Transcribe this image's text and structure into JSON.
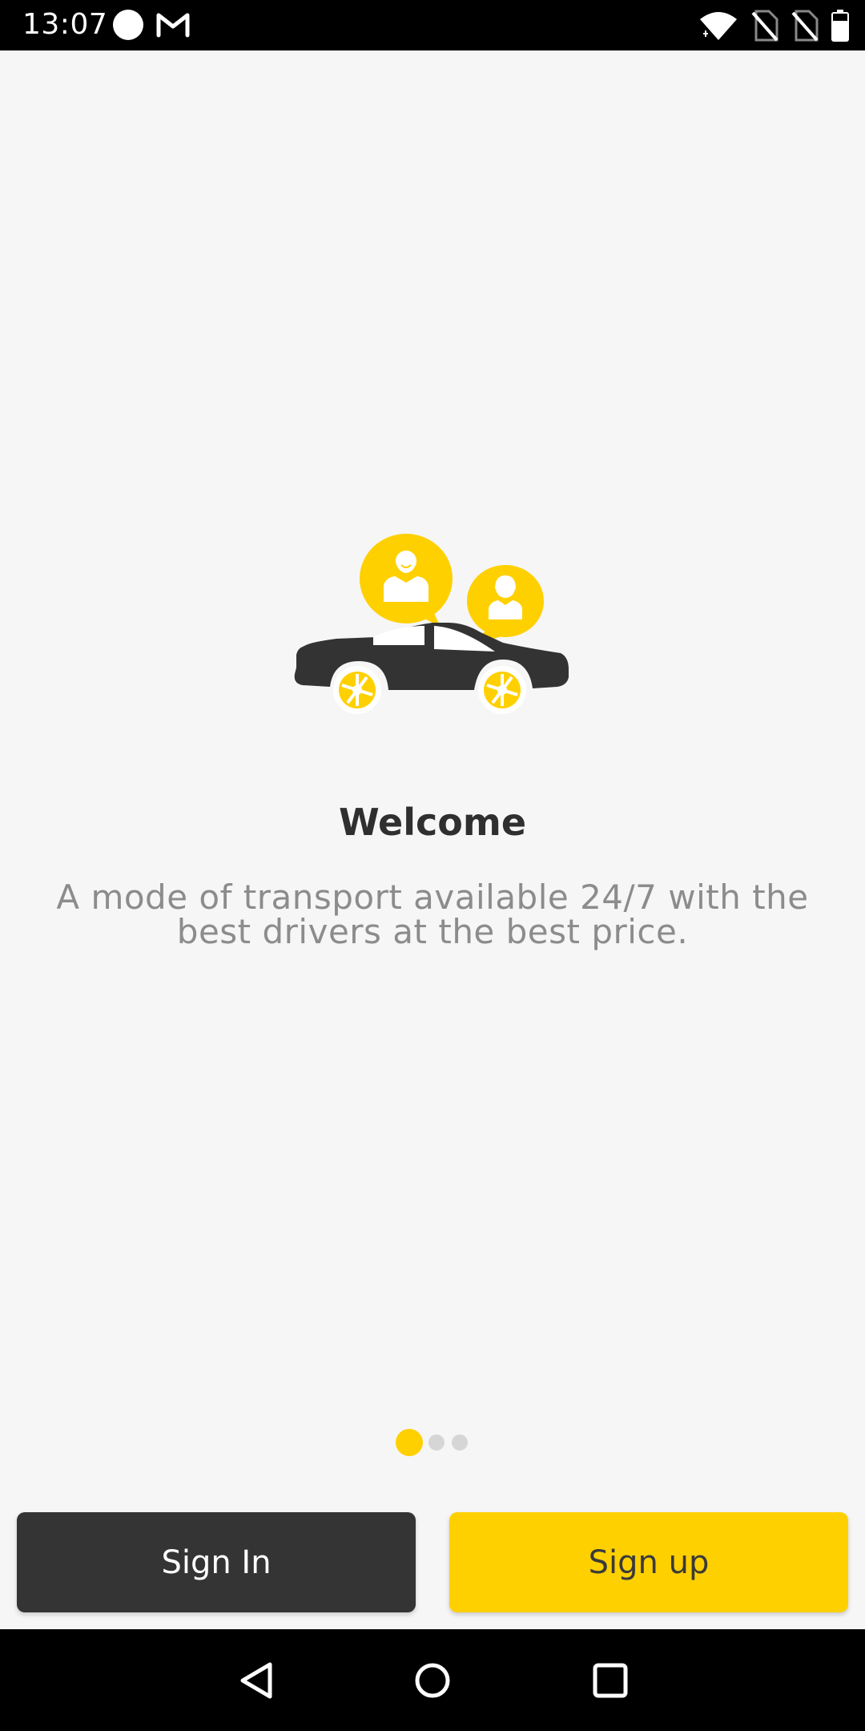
{
  "status_bar": {
    "time": "13:07",
    "icons": [
      "circle-notification-icon",
      "gmail-icon",
      "wifi-icon",
      "no-sim-icon",
      "no-sim-icon",
      "battery-icon"
    ]
  },
  "welcome": {
    "title": "Welcome",
    "description": "A mode of transport available 24/7 with the best drivers at the best price.",
    "illustration": "car-with-chat-bubbles-icon"
  },
  "pager": {
    "total": 3,
    "active_index": 0
  },
  "buttons": {
    "sign_in": "Sign In",
    "sign_up": "Sign up"
  },
  "nav_bar": {
    "icons": [
      "back-icon",
      "home-icon",
      "recents-icon"
    ]
  },
  "colors": {
    "accent": "#ffd000",
    "dark": "#343434",
    "background": "#f6f6f6",
    "text_primary": "#2f2f2f",
    "text_secondary": "#8c8c8c",
    "dot_inactive": "#d6d6d6"
  }
}
